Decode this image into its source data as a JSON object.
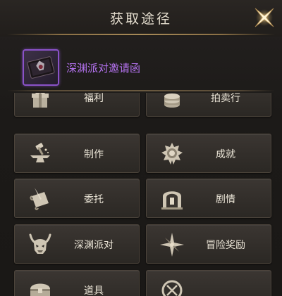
{
  "header": {
    "title": "获取途径"
  },
  "item": {
    "name": "深渊派对邀请函"
  },
  "sources": [
    {
      "label": "福利",
      "icon": "gift-icon"
    },
    {
      "label": "拍卖行",
      "icon": "coin-stack-icon"
    },
    {
      "label": "制作",
      "icon": "anvil-hammer-icon"
    },
    {
      "label": "成就",
      "icon": "medal-icon"
    },
    {
      "label": "委托",
      "icon": "scroll-quill-icon"
    },
    {
      "label": "剧情",
      "icon": "gate-icon"
    },
    {
      "label": "深渊派对",
      "icon": "demon-skull-icon"
    },
    {
      "label": "冒险奖励",
      "icon": "compass-star-icon"
    },
    {
      "label": "道具",
      "icon": "chest-icon"
    },
    {
      "label": "",
      "icon": "map-icon"
    }
  ],
  "colors": {
    "item_name": "#b472ef",
    "item_border": "#8a52c8",
    "label": "#eae4d6",
    "gold": "#c7a56a"
  }
}
